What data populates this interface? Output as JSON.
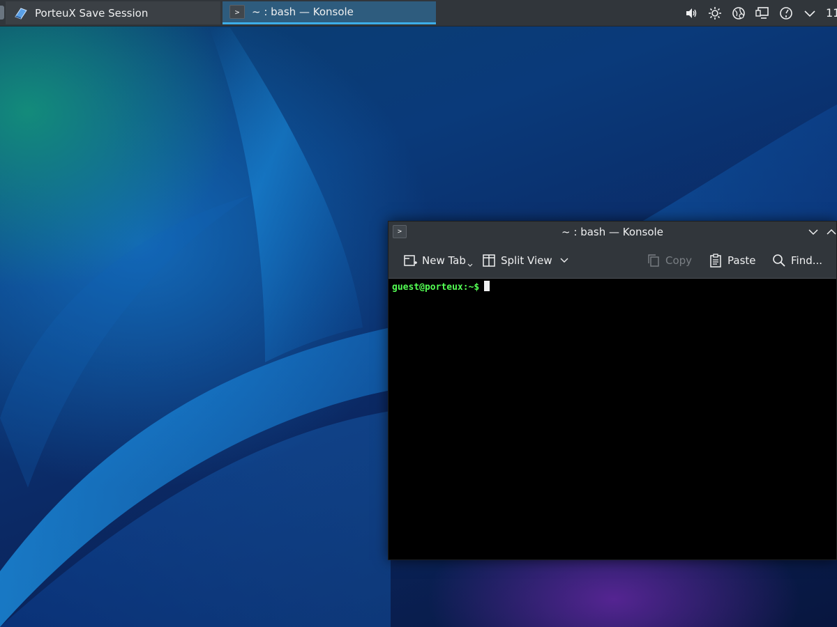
{
  "taskbar": {
    "tasks": [
      {
        "label": "PorteuX Save Session",
        "icon": "save-session-icon"
      },
      {
        "label": "~ : bash — Konsole",
        "icon": "terminal-icon",
        "active": true
      }
    ],
    "tray": {
      "icons": [
        "volume-icon",
        "brightness-icon",
        "network-icon",
        "display-icon",
        "performance-icon",
        "expand-tray-icon"
      ],
      "clock": "11"
    }
  },
  "window": {
    "title": "~ : bash — Konsole",
    "toolbar": {
      "new_tab": "New Tab",
      "split_view": "Split View",
      "copy": "Copy",
      "paste": "Paste",
      "find": "Find..."
    },
    "terminal": {
      "prompt": "guest@porteux:~$"
    }
  },
  "colors": {
    "panel": "#31363b",
    "active_task": "#2e5c7e",
    "accent": "#3daee9",
    "prompt_green": "#54ff54"
  }
}
